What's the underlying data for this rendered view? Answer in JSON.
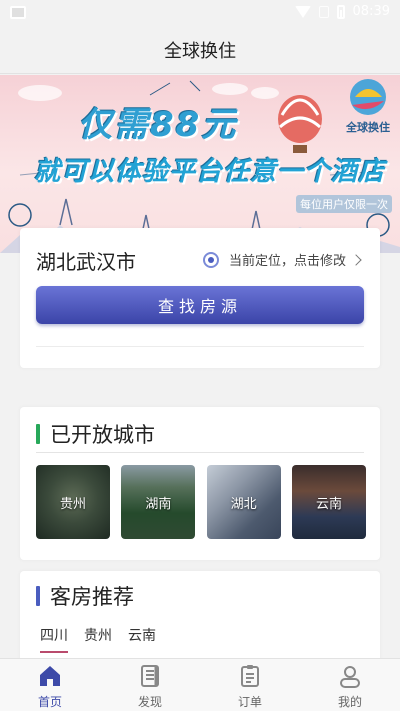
{
  "status_bar": {
    "time": "08:39"
  },
  "header": {
    "title": "全球换住"
  },
  "banner": {
    "headline": "仅需88元",
    "subline": "就可以体验平台任意一个酒店",
    "brand": "全球换住",
    "note": "每位用户仅限一次"
  },
  "search": {
    "city": "湖北武汉市",
    "location_hint": "当前定位，点击修改",
    "button_label": "查找房源"
  },
  "open_cities": {
    "title": "已开放城市",
    "accent_color": "#27a85a",
    "cities": [
      {
        "name": "贵州"
      },
      {
        "name": "湖南"
      },
      {
        "name": "湖北"
      },
      {
        "name": "云南"
      }
    ]
  },
  "recommend": {
    "title": "客房推荐",
    "accent_color": "#4a5dbf",
    "tabs": [
      {
        "label": "四川",
        "active": true
      },
      {
        "label": "贵州",
        "active": false
      },
      {
        "label": "云南",
        "active": false
      }
    ]
  },
  "bottom_nav": {
    "items": [
      {
        "label": "首页",
        "icon": "home-icon",
        "active": true
      },
      {
        "label": "发现",
        "icon": "discover-icon",
        "active": false
      },
      {
        "label": "订单",
        "icon": "orders-icon",
        "active": false
      },
      {
        "label": "我的",
        "icon": "profile-icon",
        "active": false
      }
    ]
  },
  "colors": {
    "primary": "#3d4aa8",
    "button_gradient_top": "#6a74d6",
    "button_gradient_bottom": "#3b44a8",
    "tab_underline": "#b94a6c"
  }
}
